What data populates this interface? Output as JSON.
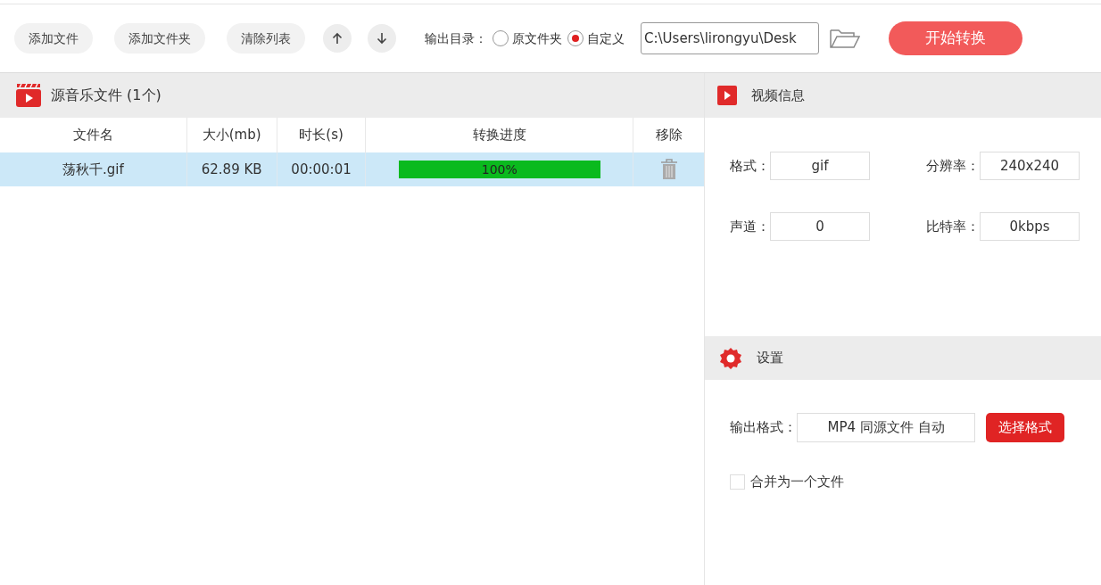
{
  "toolbar": {
    "buttons": [
      "添加文件",
      "添加文件夹",
      "清除列表"
    ],
    "output_dir": {
      "label": "输出目录：",
      "options": [
        {
          "label": "原文件夹",
          "selected": false
        },
        {
          "label": "自定义",
          "selected": true
        }
      ],
      "path": "C:\\Users\\lirongyu\\Desk"
    },
    "start_button": "开始转换"
  },
  "file_panel": {
    "title": "源音乐文件 (1个)",
    "columns": [
      "文件名",
      "大小(mb)",
      "时长(s)",
      "转换进度",
      "移除"
    ],
    "rows": [
      {
        "name": "荡秋千.gif",
        "size": "62.89 KB",
        "duration": "00:00:01",
        "level": 1,
        "reading": "100%",
        "selected": true
      }
    ]
  },
  "video_info": {
    "title": "视频信息",
    "fields": [
      {
        "label": "格式：",
        "value": "gif"
      },
      {
        "label": "分辨率：",
        "value": "240x240"
      },
      {
        "label": "声道：",
        "value": "0"
      },
      {
        "label": "比特率：",
        "value": "0kbps"
      }
    ]
  },
  "settings": {
    "title": "设置",
    "output_format": {
      "label": "输出格式：",
      "value": "MP4 同源文件 自动"
    },
    "choose_button": "选择格式",
    "merge": {
      "label": "合并为一个文件",
      "checked": false
    }
  }
}
